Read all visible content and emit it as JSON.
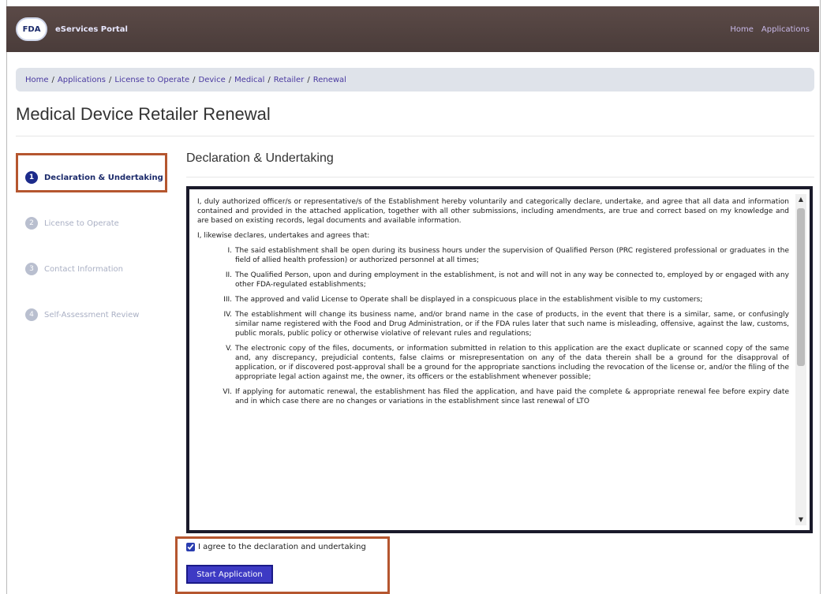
{
  "header": {
    "logo_text": "FDA",
    "brand": "eServices Portal",
    "nav": [
      "Home",
      "Applications"
    ]
  },
  "breadcrumb": [
    "Home",
    "Applications",
    "License to Operate",
    "Device",
    "Medical",
    "Retailer",
    "Renewal"
  ],
  "page_title": "Medical Device Retailer Renewal",
  "steps": [
    {
      "num": "1",
      "label": "Declaration & Undertaking",
      "active": true
    },
    {
      "num": "2",
      "label": "License to Operate",
      "active": false
    },
    {
      "num": "3",
      "label": "Contact Information",
      "active": false
    },
    {
      "num": "4",
      "label": "Self-Assessment Review",
      "active": false
    }
  ],
  "section_title": "Declaration & Undertaking",
  "declaration": {
    "intro": "I, duly authorized officer/s or representative/s of the Establishment hereby voluntarily and categorically declare, undertake, and agree that all data and information contained and provided in the attached application, together with all other submissions, including amendments, are true and correct based on my knowledge and are based on existing records, legal documents and available information.",
    "lead": "I, likewise declares, undertakes and agrees that:",
    "items": [
      {
        "num": "I.",
        "text": "The said establishment shall be open during its business hours under the supervision of Qualified Person (PRC registered professional or graduates in the field of allied health profession) or authorized personnel at all times;"
      },
      {
        "num": "II.",
        "text": "The Qualified Person, upon and during employment in the establishment, is not and will not in any way be connected to, employed by or engaged with any other FDA-regulated establishments;"
      },
      {
        "num": "III.",
        "text": "The approved and valid License to Operate shall be displayed in a conspicuous place in the establishment visible to my customers;"
      },
      {
        "num": "IV.",
        "text": "The establishment will change its business name, and/or brand name in the case of products, in the event that there is a similar, same, or confusingly similar name registered with the Food and Drug Administration, or if the FDA rules later that such name is misleading, offensive, against the law, customs, public morals, public policy or otherwise violative of relevant rules and regulations;"
      },
      {
        "num": "V.",
        "text": "The electronic copy of the files, documents, or information submitted in relation to this application are the exact duplicate or scanned copy of the same and, any discrepancy, prejudicial contents, false claims or misrepresentation on any of the data therein shall be a ground for the disapproval of application, or if discovered post-approval shall be a ground for the appropriate sanctions including the revocation of the license or, and/or the filing of the appropriate legal action against me, the owner, its officers or the establishment whenever possible;"
      },
      {
        "num": "VI.",
        "text": "If applying for automatic renewal, the establishment has filed the application, and have paid the complete & appropriate renewal fee before expiry date and in which case there are no changes or variations in the establishment since last renewal of LTO"
      }
    ]
  },
  "agree_label": "I agree to the declaration and undertaking",
  "start_button": "Start Application",
  "colors": {
    "accent": "#3d3ac4",
    "highlight": "#b5562f",
    "header": "#4a3c3a"
  }
}
